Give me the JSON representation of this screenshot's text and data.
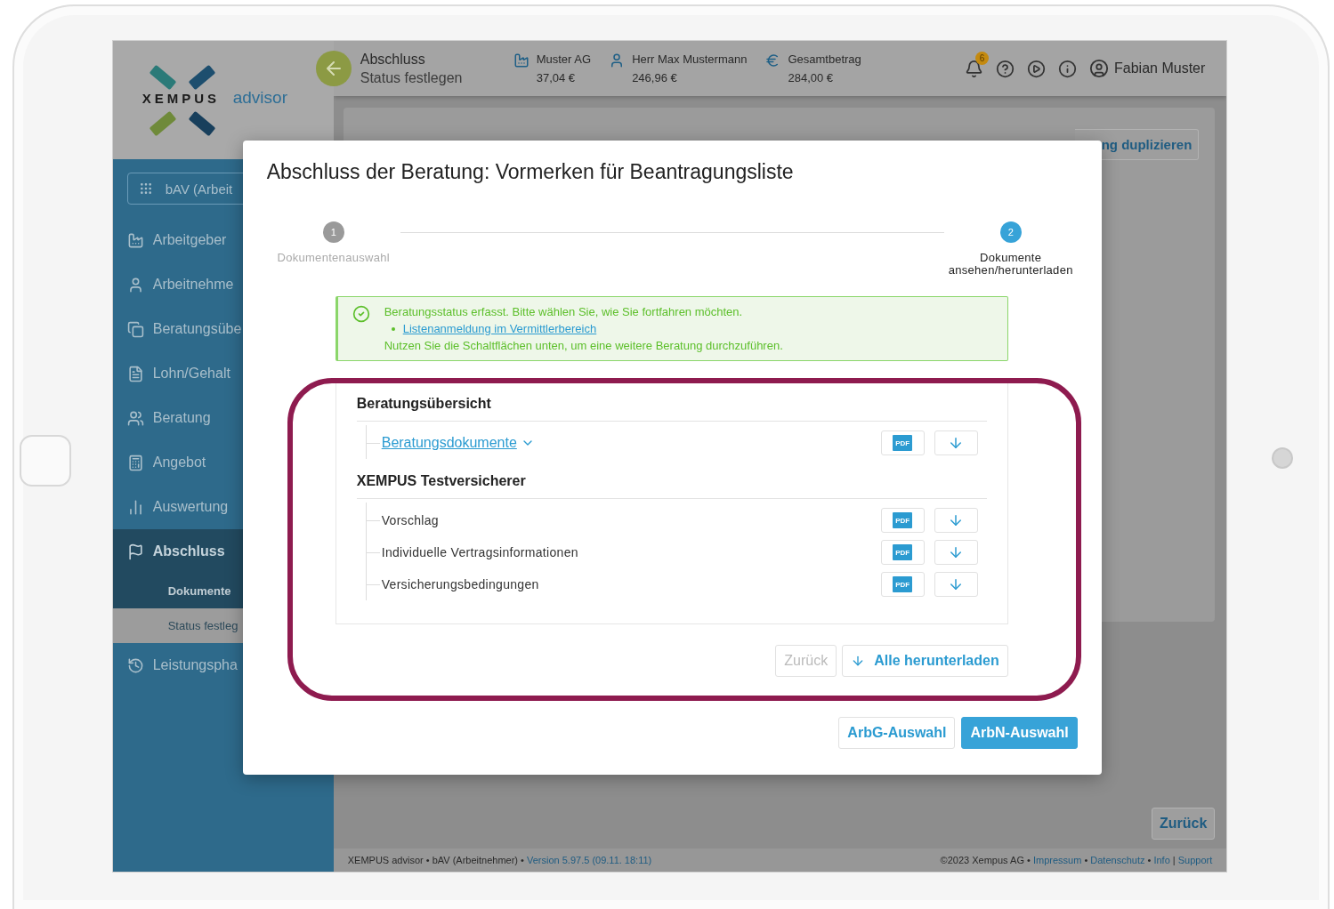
{
  "sidebar": {
    "logo": {
      "brand": "XEMPUS",
      "product": "advisor"
    },
    "module_select": "bAV (Arbeit",
    "items": [
      {
        "label": "Arbeitgeber",
        "selected": false
      },
      {
        "label": "Arbeitnehme",
        "selected": false
      },
      {
        "label": "Beratungsübe",
        "selected": false
      },
      {
        "label": "Lohn/Gehalt",
        "selected": false
      },
      {
        "label": "Beratung",
        "selected": false
      },
      {
        "label": "Angebot",
        "selected": false
      },
      {
        "label": "Auswertung",
        "selected": false
      },
      {
        "label": "Abschluss",
        "selected": true,
        "children": [
          {
            "label": "Dokumente",
            "selected": false
          },
          {
            "label": "Status festleg",
            "selected": true
          }
        ]
      },
      {
        "label": "Leistungspha",
        "selected": false
      }
    ]
  },
  "topbar": {
    "title": "Abschluss",
    "subtitle": "Status festlegen",
    "summary": [
      {
        "label": "Muster AG",
        "value": "37,04 €"
      },
      {
        "label": "Herr Max Mustermann",
        "value": "246,96 €"
      },
      {
        "label": "Gesamtbetrag",
        "value": "284,00 €"
      }
    ],
    "notifications": "6",
    "user": "Fabian Muster"
  },
  "page": {
    "duplicate_button": "ng duplizieren",
    "back_button": "Zurück"
  },
  "footer": {
    "left": "XEMPUS advisor • bAV (Arbeitnehmer) •",
    "version": "Version 5.97.5 (09.11. 18:11)",
    "copyright": "©2023 Xempus AG •",
    "links": [
      "Impressum",
      "Datenschutz",
      "Info",
      "Support"
    ],
    "separators": [
      "•",
      "•",
      "|"
    ]
  },
  "dialog": {
    "title": "Abschluss der Beratung: Vormerken für Beantragungsliste",
    "steps": [
      {
        "number": "1",
        "label": "Dokumentenauswahl",
        "selected": false
      },
      {
        "number": "2",
        "label": "Dokumente ansehen/herunterladen",
        "selected": true
      }
    ],
    "alert": {
      "message": "Beratungsstatus erfasst. Bitte wählen Sie, wie Sie fortfahren möchten.",
      "link": "Listenanmeldung im Vermittlerbereich",
      "note": "Nutzen Sie die Schaltflächen unten, um eine weitere Beratung durchzuführen."
    },
    "sections": [
      {
        "title": "Beratungsübersicht",
        "documents": [
          {
            "label": "Beratungsdokumente",
            "kind": "link",
            "pdf": "PDF"
          }
        ]
      },
      {
        "title": "XEMPUS Testversicherer",
        "documents": [
          {
            "label": "Vorschlag",
            "kind": "plain",
            "pdf": "PDF"
          },
          {
            "label": "Individuelle Vertragsinformationen",
            "kind": "plain",
            "pdf": "PDF"
          },
          {
            "label": "Versicherungsbedingungen",
            "kind": "plain",
            "pdf": "PDF"
          }
        ]
      }
    ],
    "back_button": {
      "label": "Zurück",
      "disabled": true
    },
    "download_all": "Alle herunterladen",
    "actions": [
      {
        "label": "ArbG-Auswahl",
        "primary": false
      },
      {
        "label": "ArbN-Auswahl",
        "primary": true
      }
    ]
  }
}
